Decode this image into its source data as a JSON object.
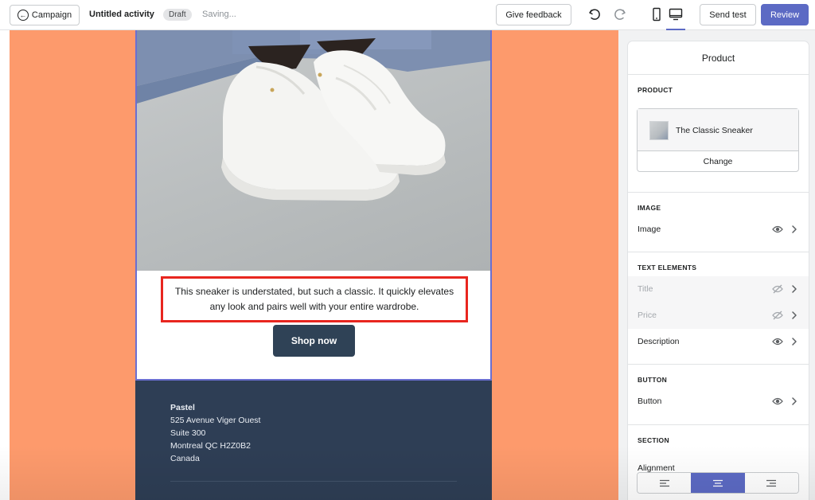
{
  "topbar": {
    "back_label": "Campaign",
    "title": "Untitled activity",
    "status_badge": "Draft",
    "saving_text": "Saving...",
    "feedback_label": "Give feedback",
    "send_test_label": "Send test",
    "review_label": "Review"
  },
  "email": {
    "description": "This sneaker is understated, but such a classic. It quickly elevates any look and pairs well with your entire wardrobe.",
    "cta_label": "Shop now",
    "footer": {
      "brand": "Pastel",
      "address_line1": "525 Avenue Viger Ouest",
      "address_line2": "Suite 300",
      "address_line3": "Montreal QC H2Z0B2",
      "address_line4": "Canada"
    }
  },
  "panel": {
    "heading": "Product",
    "product_section": "PRODUCT",
    "product_name": "The Classic Sneaker",
    "change_label": "Change",
    "image_section": "IMAGE",
    "image_row": "Image",
    "text_section": "TEXT ELEMENTS",
    "title_row": "Title",
    "price_row": "Price",
    "description_row": "Description",
    "button_section": "BUTTON",
    "button_row": "Button",
    "section_section": "SECTION",
    "alignment_label": "Alignment",
    "selected_alignment": "center"
  },
  "colors": {
    "accent": "#5c6ac4",
    "canvas_background": "#fd9a6c",
    "footer_background": "#2e3e55",
    "cta_background": "#2f4256",
    "highlight_border": "#e8261f"
  }
}
